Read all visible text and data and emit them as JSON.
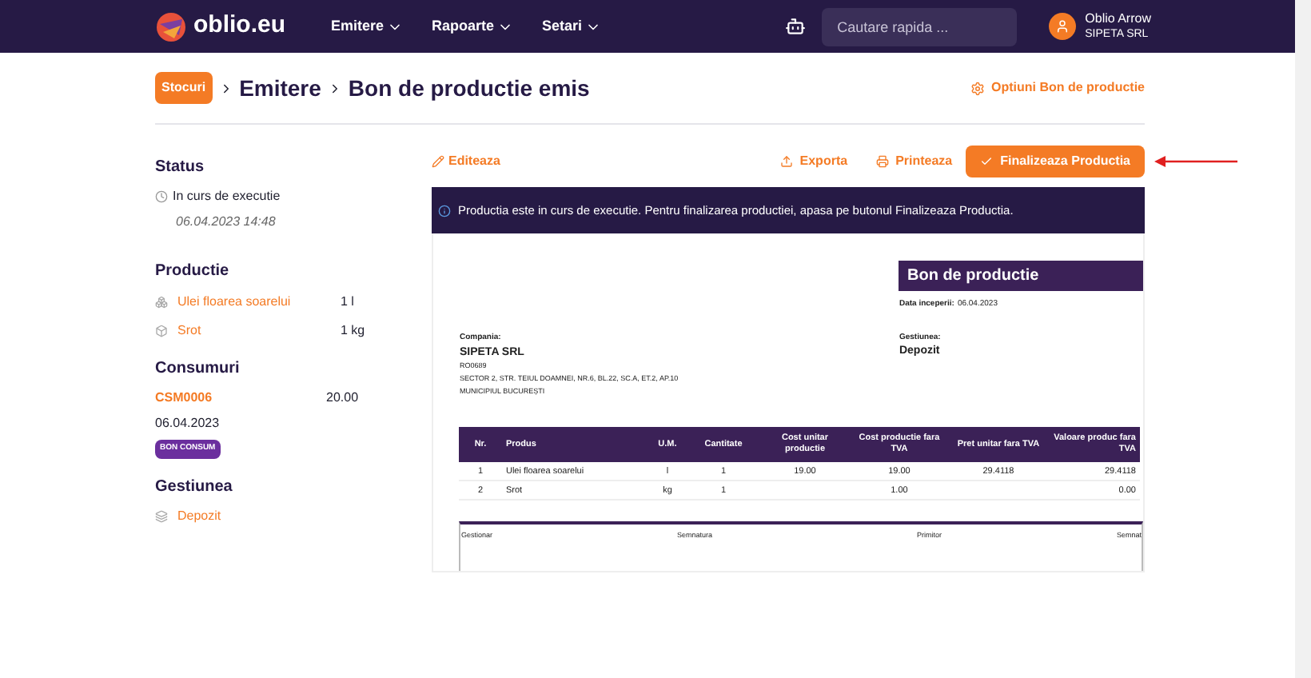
{
  "nav": {
    "logo": "oblio.eu",
    "menus": [
      {
        "label": "Emitere"
      },
      {
        "label": "Rapoarte"
      },
      {
        "label": "Setari"
      }
    ],
    "search": {
      "placeholder": "Cautare rapida ..."
    },
    "user": {
      "name": "Oblio Arrow",
      "company": "SIPETA SRL"
    }
  },
  "breadcrumb": {
    "badge": "Stocuri",
    "items": [
      "Emitere",
      "Bon de productie emis"
    ],
    "options": "Optiuni Bon de productie"
  },
  "sidebar": {
    "status": {
      "title": "Status",
      "value": "In curs de executie",
      "date": "06.04.2023 14:48"
    },
    "productie": {
      "title": "Productie",
      "items": [
        {
          "kind": "product",
          "name": "Ulei floarea soarelui",
          "qty": "1 l"
        },
        {
          "kind": "box",
          "name": "Srot",
          "qty": "1 kg"
        }
      ]
    },
    "consumuri": {
      "title": "Consumuri",
      "code": "CSM0006",
      "amount": "20.00",
      "date": "06.04.2023",
      "badge": "BON CONSUM"
    },
    "gestiunea": {
      "title": "Gestiunea",
      "value": "Depozit"
    }
  },
  "actions": {
    "edit": "Editeaza",
    "export": "Exporta",
    "print": "Printeaza",
    "finalize": "Finalizeaza Productia"
  },
  "notice": "Productia este in curs de executie. Pentru finalizarea productiei, apasa pe butonul Finalizeaza Productia.",
  "document": {
    "title": "Bon de productie",
    "start_label": "Data inceperii:",
    "start_date": "06.04.2023",
    "company_label": "Compania:",
    "company": "SIPETA SRL",
    "company_code": "RO0689",
    "address": "SECTOR 2, STR. TEIUL DOAMNEI, NR.6, BL.22, SC.A, ET.2, AP.10",
    "city": "MUNICIPIUL BUCUREȘTI",
    "gestiune_label": "Gestiunea:",
    "gestiune": "Depozit",
    "table": {
      "columns": [
        "Nr.",
        "Produs",
        "U.M.",
        "Cantitate",
        "Cost unitar productie",
        "Cost productie fara TVA",
        "Pret unitar fara TVA",
        "Valoare produc fara TVA"
      ],
      "rows": [
        [
          "1",
          "Ulei floarea soarelui",
          "l",
          "1",
          "19.00",
          "19.00",
          "29.4118",
          "29.4118"
        ],
        [
          "2",
          "Srot",
          "kg",
          "1",
          "",
          "1.00",
          "",
          "0.00"
        ]
      ]
    },
    "signatures": [
      "Gestionar",
      "Semnatura",
      "Primitor",
      "Semnat"
    ]
  }
}
